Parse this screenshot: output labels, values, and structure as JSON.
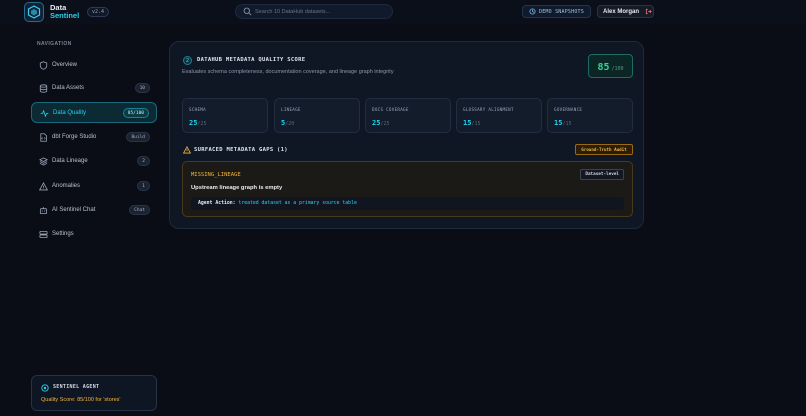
{
  "app": {
    "brand_line1": "Data",
    "brand_line2": "Sentinel",
    "version": "v2.4"
  },
  "search": {
    "placeholder": "Search 10 DataHub datasets..."
  },
  "header": {
    "demo_label": "DEMO SNAPSHOTS",
    "user_name": "Alex Morgan"
  },
  "sidebar": {
    "heading": "NAVIGATION",
    "items": [
      {
        "label": "Overview",
        "badge": "",
        "icon": "shield-icon"
      },
      {
        "label": "Data Assets",
        "badge": "10",
        "icon": "database-icon"
      },
      {
        "label": "Data Quality",
        "badge": "85/100",
        "icon": "activity-icon",
        "active": true
      },
      {
        "label": "dbt Forge Studio",
        "badge": "Build",
        "icon": "file-code-icon"
      },
      {
        "label": "Data Lineage",
        "badge": "2",
        "icon": "layers-icon"
      },
      {
        "label": "Anomalies",
        "badge": "1",
        "icon": "alert-triangle-icon"
      },
      {
        "label": "AI Sentinel Chat",
        "badge": "Chat",
        "icon": "bot-icon"
      },
      {
        "label": "Settings",
        "badge": "",
        "icon": "settings-icon"
      }
    ]
  },
  "agent": {
    "title": "SENTINEL AGENT",
    "status": "Quality Score: 85/100 for 'stores'"
  },
  "quality": {
    "index": "2",
    "title": "DATAHUB METADATA QUALITY SCORE",
    "subtitle": "Evaluates schema completeness, documentation coverage, and lineage graph integrity",
    "score": "85",
    "score_max": "/100",
    "metrics": [
      {
        "label": "SCHEMA",
        "value": "25",
        "max": "/25"
      },
      {
        "label": "LINEAGE",
        "value": "5",
        "max": "/20"
      },
      {
        "label": "DOCS COVERAGE",
        "value": "25",
        "max": "/25"
      },
      {
        "label": "GLOSSARY ALIGNMENT",
        "value": "15",
        "max": "/15"
      },
      {
        "label": "GOVERNANCE",
        "value": "15",
        "max": "/15"
      }
    ],
    "gaps_title": "SURFACED METADATA GAPS (1)",
    "audit_badge": "Ground-Truth Audit",
    "gap": {
      "code": "MISSING_LINEAGE",
      "level": "Dataset-level",
      "message": "Upstream lineage graph is empty",
      "action_label": "Agent Action:",
      "action_value": "treated dataset as a primary source table"
    }
  },
  "colors": {
    "accent": "#22d3ee",
    "score_green": "#34d399",
    "warning": "#f5b53d",
    "background": "#0a0d16"
  }
}
